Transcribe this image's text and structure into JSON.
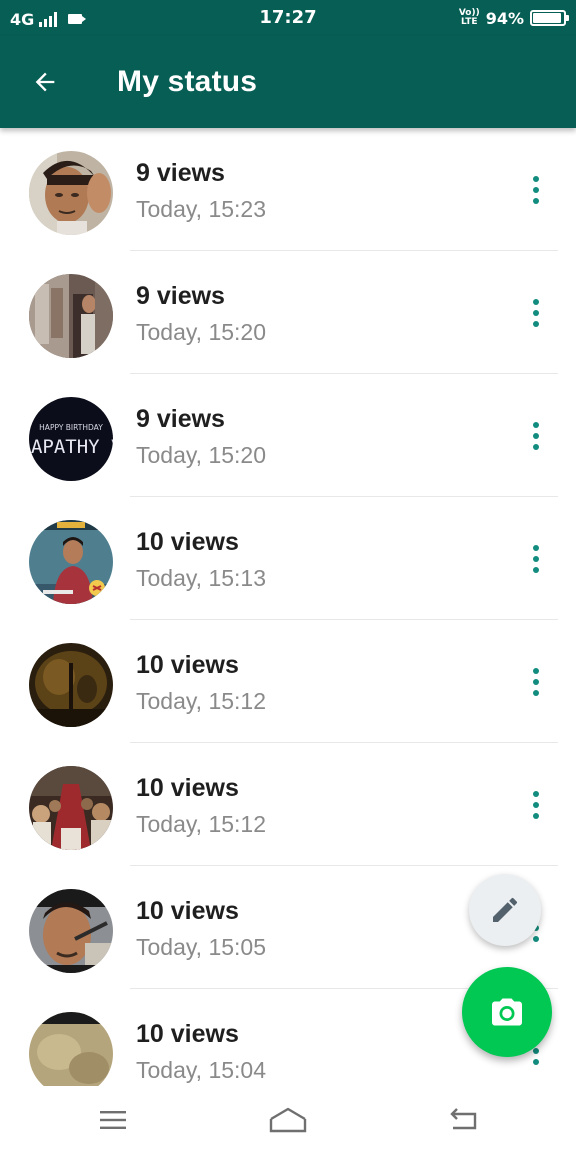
{
  "status_bar": {
    "network": "4G",
    "time": "17:27",
    "volte_top": "Vo))",
    "volte_bottom": "LTE",
    "battery": "94%",
    "battery_level": 0.94
  },
  "app_bar": {
    "back_icon": "arrow-back-icon",
    "title": "My status",
    "background": "#075e54"
  },
  "statuses": [
    {
      "views": "9 views",
      "time": "Today, 15:23"
    },
    {
      "views": "9 views",
      "time": "Today, 15:20"
    },
    {
      "views": "9 views",
      "time": "Today, 15:20",
      "thumb_text_1": "HAPPY BIRTHDAY",
      "thumb_text_2": "LAPATHY V"
    },
    {
      "views": "10 views",
      "time": "Today, 15:13"
    },
    {
      "views": "10 views",
      "time": "Today, 15:12"
    },
    {
      "views": "10 views",
      "time": "Today, 15:12"
    },
    {
      "views": "10 views",
      "time": "Today, 15:05"
    },
    {
      "views": "10 views",
      "time": "Today, 15:04"
    }
  ],
  "actions": {
    "more_icon": "more-vert-icon",
    "edit_icon": "pencil-icon",
    "camera_icon": "camera-icon",
    "accent": "#128c7e",
    "camera_fab_color": "#00c853"
  },
  "nav_bar": {
    "icons": [
      "menu-icon",
      "home-icon",
      "back-icon"
    ]
  }
}
